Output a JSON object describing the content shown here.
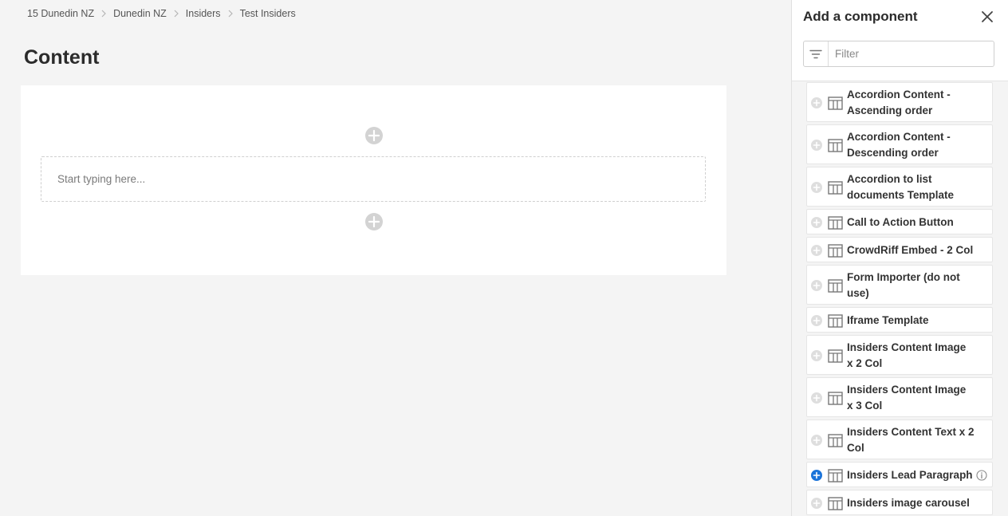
{
  "breadcrumb": [
    "15 Dunedin NZ",
    "Dunedin NZ",
    "Insiders",
    "Test Insiders"
  ],
  "page": {
    "title": "Content",
    "editor_placeholder": "Start typing here..."
  },
  "panel": {
    "title": "Add a component",
    "filter_placeholder": "Filter",
    "components": [
      {
        "label": "Accordion Content - Ascending order",
        "icon": "table-icon"
      },
      {
        "label": "Accordion Content - Descending order",
        "icon": "table-icon"
      },
      {
        "label": "Accordion to list documents Template",
        "icon": "table-icon"
      },
      {
        "label": "Call to Action Button",
        "icon": "table-icon"
      },
      {
        "label": "CrowdRiff Embed - 2 Col",
        "icon": "table-icon"
      },
      {
        "label": "Form Importer (do not use)",
        "icon": "table-icon"
      },
      {
        "label": "Iframe Template",
        "icon": "table-icon"
      },
      {
        "label": "Insiders Content Image x 2 Col",
        "icon": "table-icon"
      },
      {
        "label": "Insiders Content Image x 3 Col",
        "icon": "table-icon"
      },
      {
        "label": "Insiders Content Text x 2 Col",
        "icon": "table-icon"
      },
      {
        "label": "Insiders Lead Paragraph",
        "icon": "table-icon",
        "highlighted": true
      },
      {
        "label": "Insiders image carousel",
        "icon": "table-icon"
      }
    ]
  },
  "colors": {
    "accent": "#1a73d9",
    "background": "#f4f4f4"
  }
}
